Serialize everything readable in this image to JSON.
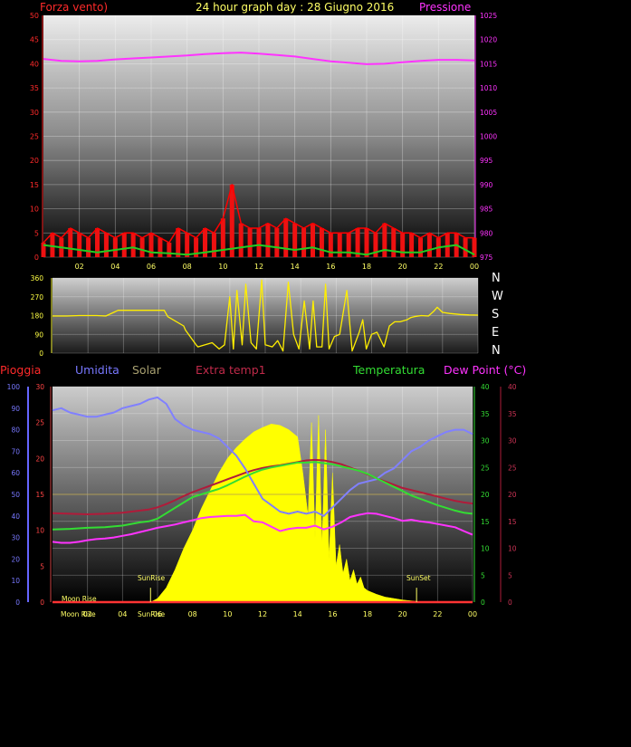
{
  "colors": {
    "background": "#000000",
    "wind_axis": "#ff2a2a",
    "pressure_axis": "#ff33ff",
    "time_ticks": "#ffff66",
    "dir_axis": "#ffff44",
    "rain_axis": "#6666ff",
    "humidity": "#8080ff",
    "solar": "#ffff00",
    "extra_temp": "#b01b3a",
    "temperature": "#33dd33",
    "dew_point": "#ff33ff"
  },
  "chart_data": [
    {
      "type": "line",
      "title": "24 hour graph day : 28 Giugno 2016",
      "ylabel_left": "Forza vento)",
      "ylabel_right": "Pressione",
      "x_ticks": [
        "02",
        "04",
        "06",
        "08",
        "10",
        "12",
        "14",
        "16",
        "18",
        "20",
        "22",
        "00"
      ],
      "y_left_ticks": [
        "0",
        "5",
        "10",
        "15",
        "20",
        "25",
        "30",
        "35",
        "40",
        "45",
        "50"
      ],
      "y_right_ticks": [
        "975",
        "980",
        "985",
        "990",
        "995",
        "1000",
        "1005",
        "1010",
        "1015",
        "1020",
        "1025"
      ],
      "ylim_left": [
        0,
        50
      ],
      "ylim_right": [
        975,
        1025
      ],
      "series": [
        {
          "axis": "right",
          "x": [
            0,
            1,
            2,
            3,
            4,
            5,
            6,
            7,
            8,
            9,
            10,
            11,
            12,
            13,
            14,
            15,
            16,
            17,
            18,
            19,
            20,
            21,
            22,
            23,
            24
          ],
          "values": [
            1016.0,
            1015.6,
            1015.5,
            1015.6,
            1015.9,
            1016.1,
            1016.3,
            1016.5,
            1016.7,
            1017.0,
            1017.2,
            1017.3,
            1017.1,
            1016.8,
            1016.5,
            1016.0,
            1015.5,
            1015.2,
            1014.9,
            1015.0,
            1015.3,
            1015.6,
            1015.8,
            1015.8,
            1015.7
          ]
        },
        {
          "axis": "left",
          "x": [
            0,
            0.5,
            1,
            1.5,
            2,
            2.5,
            3,
            3.5,
            4,
            4.5,
            5,
            5.5,
            6,
            6.5,
            7,
            7.5,
            8,
            8.5,
            9,
            9.5,
            10,
            10.5,
            11,
            11.5,
            12,
            12.5,
            13,
            13.5,
            14,
            14.5,
            15,
            15.5,
            16,
            16.5,
            17,
            17.5,
            18,
            18.5,
            19,
            19.5,
            20,
            20.5,
            21,
            21.5,
            22,
            22.5,
            23,
            23.5,
            24
          ],
          "values": [
            3,
            5,
            4,
            6,
            5,
            4,
            6,
            5,
            4,
            5,
            5,
            4,
            5,
            4,
            3,
            6,
            5,
            4,
            6,
            5,
            8,
            15,
            7,
            6,
            6,
            7,
            6,
            8,
            7,
            6,
            7,
            6,
            5,
            5,
            5,
            6,
            6,
            5,
            7,
            6,
            5,
            5,
            4,
            5,
            4,
            5,
            5,
            4,
            4
          ]
        },
        {
          "axis": "left",
          "x": [
            0,
            1,
            2,
            3,
            4,
            5,
            6,
            7,
            8,
            9,
            10,
            11,
            12,
            13,
            14,
            15,
            16,
            17,
            18,
            19,
            20,
            21,
            22,
            23,
            24
          ],
          "values": [
            2.5,
            2.0,
            1.5,
            1.0,
            1.5,
            2.0,
            1.0,
            0.8,
            0.5,
            1.0,
            1.5,
            2.0,
            2.5,
            2.0,
            1.5,
            2.0,
            1.0,
            1.0,
            0.5,
            1.5,
            1.0,
            1.0,
            2.0,
            2.5,
            0.5
          ]
        }
      ]
    },
    {
      "type": "line",
      "right_labels": [
        "N",
        "W",
        "S",
        "E",
        "N"
      ],
      "y_ticks": [
        "0",
        "90",
        "180",
        "270",
        "360"
      ],
      "ylim": [
        0,
        360
      ],
      "series": [
        {
          "x": [
            0,
            0.8,
            1.5,
            2.5,
            3.0,
            3.7,
            5.0,
            6.3,
            6.5,
            7.4,
            7.5,
            8.1,
            8.2,
            9.0,
            9.4,
            9.7,
            10.0,
            10.2,
            10.4,
            10.7,
            10.9,
            11.2,
            11.5,
            11.8,
            12.0,
            12.4,
            12.7,
            13.0,
            13.3,
            13.6,
            13.9,
            14.2,
            14.5,
            14.7,
            14.9,
            15.2,
            15.4,
            15.6,
            15.9,
            16.2,
            16.6,
            16.9,
            17.3,
            17.5,
            17.7,
            18.0,
            18.3,
            18.7,
            19.0,
            19.3,
            19.6,
            20.0,
            20.2,
            20.4,
            20.8,
            21.2,
            21.5,
            21.6,
            21.7,
            22.0,
            22.4,
            23.0,
            23.5,
            24.0
          ],
          "values": [
            178,
            178,
            180,
            180,
            178,
            205,
            205,
            205,
            175,
            130,
            110,
            40,
            30,
            50,
            20,
            40,
            270,
            20,
            300,
            40,
            330,
            50,
            20,
            350,
            40,
            30,
            60,
            10,
            340,
            90,
            20,
            250,
            20,
            250,
            30,
            30,
            330,
            20,
            80,
            90,
            300,
            10,
            100,
            160,
            20,
            90,
            100,
            30,
            130,
            150,
            150,
            160,
            170,
            175,
            180,
            178,
            200,
            210,
            220,
            195,
            190,
            185,
            183,
            182
          ]
        }
      ]
    },
    {
      "type": "line",
      "legend": [
        "Pioggia",
        "Umidita",
        "Solar",
        "Extra temp1",
        "Temperatura",
        "Dew Point (°C)"
      ],
      "y_rain_ticks": [
        "0",
        "10",
        "20",
        "30",
        "40",
        "50",
        "60",
        "70",
        "80",
        "90",
        "100"
      ],
      "y_solar_ticks": [
        "0",
        "5",
        "10",
        "15",
        "20",
        "25",
        "30"
      ],
      "y_temp_ticks": [
        "0",
        "5",
        "10",
        "15",
        "20",
        "25",
        "30",
        "35",
        "40"
      ],
      "y_dew_ticks": [
        "0",
        "5",
        "10",
        "15",
        "20",
        "25",
        "30",
        "35",
        "40"
      ],
      "ylim": [
        0,
        40
      ],
      "markers": [
        "Moon Rise",
        "SunRise",
        "SunSet"
      ],
      "series": [
        {
          "name": "Umidita",
          "axis": "humidity",
          "x": [
            0,
            0.5,
            1,
            1.5,
            2,
            2.5,
            3,
            3.5,
            4,
            4.5,
            5,
            5.5,
            6,
            6.5,
            7,
            7.5,
            8,
            8.5,
            9,
            9.5,
            10,
            10.5,
            11,
            11.5,
            12,
            12.5,
            13,
            13.5,
            14,
            14.5,
            15,
            15.5,
            16,
            16.5,
            17,
            17.5,
            18,
            18.5,
            19,
            19.5,
            20,
            20.5,
            21,
            21.5,
            22,
            22.5,
            23,
            23.5,
            24
          ],
          "values": [
            89,
            90,
            88,
            87,
            86,
            86,
            87,
            88,
            90,
            91,
            92,
            94,
            95,
            92,
            85,
            82,
            80,
            79,
            78,
            76,
            72,
            68,
            62,
            55,
            48,
            45,
            42,
            41,
            42,
            41,
            42,
            40,
            44,
            48,
            52,
            55,
            56,
            57,
            60,
            62,
            66,
            70,
            72,
            75,
            77,
            79,
            80,
            80,
            78
          ]
        },
        {
          "name": "Temperatura",
          "axis": "temp",
          "x": [
            0,
            1,
            2,
            3,
            4,
            5,
            5.5,
            6,
            6.5,
            7,
            7.5,
            8,
            8.5,
            9,
            9.5,
            10,
            10.5,
            11,
            11.5,
            12,
            12.5,
            13,
            13.5,
            14,
            14.5,
            15,
            15.5,
            16,
            16.5,
            17,
            17.5,
            18,
            18.5,
            19,
            19.5,
            20,
            20.5,
            21,
            21.5,
            22,
            22.5,
            23,
            23.5,
            24
          ],
          "values": [
            13.5,
            13.6,
            13.8,
            13.9,
            14.2,
            14.8,
            15.0,
            15.5,
            16.5,
            17.5,
            18.5,
            19.5,
            20.0,
            20.5,
            21.0,
            21.7,
            22.5,
            23.3,
            24.0,
            24.6,
            25.0,
            25.3,
            25.6,
            25.9,
            25.9,
            26.0,
            25.8,
            25.6,
            25.2,
            24.8,
            24.4,
            23.8,
            23.0,
            22.2,
            21.4,
            20.6,
            19.8,
            19.2,
            18.6,
            18.0,
            17.5,
            17.0,
            16.6,
            16.4
          ]
        },
        {
          "name": "Extra temp1",
          "axis": "temp",
          "x": [
            0,
            1,
            2,
            3,
            4,
            5,
            5.5,
            6,
            6.5,
            7,
            7.5,
            8,
            8.5,
            9,
            9.5,
            10,
            10.5,
            11,
            11.5,
            12,
            12.5,
            13,
            13.5,
            14,
            14.5,
            15,
            15.5,
            16,
            16.5,
            17,
            17.5,
            18,
            18.5,
            19,
            19.5,
            20,
            20.5,
            21,
            21.5,
            22,
            22.5,
            23,
            23.5,
            24
          ],
          "values": [
            16.5,
            16.4,
            16.3,
            16.4,
            16.6,
            17.0,
            17.2,
            17.6,
            18.2,
            18.9,
            19.7,
            20.4,
            21.0,
            21.6,
            22.2,
            22.8,
            23.4,
            24.0,
            24.5,
            24.9,
            25.2,
            25.4,
            25.7,
            26.0,
            26.3,
            26.4,
            26.3,
            26.0,
            25.6,
            25.0,
            24.4,
            23.7,
            23.0,
            22.4,
            21.8,
            21.2,
            20.8,
            20.4,
            20.0,
            19.6,
            19.2,
            18.8,
            18.5,
            18.3
          ]
        },
        {
          "name": "Dew Point (°C)",
          "axis": "dew",
          "x": [
            0,
            0.5,
            1,
            1.5,
            2,
            2.5,
            3,
            3.5,
            4,
            4.5,
            5,
            5.5,
            6,
            6.5,
            7,
            7.5,
            8,
            8.5,
            9,
            9.5,
            10,
            10.5,
            11,
            11.5,
            12,
            12.5,
            13,
            13.5,
            14,
            14.5,
            15,
            15.5,
            16,
            16.5,
            17,
            17.5,
            18,
            18.5,
            19,
            19.5,
            20,
            20.5,
            21,
            21.5,
            22,
            22.5,
            23,
            23.5,
            24
          ],
          "values": [
            11.2,
            11.0,
            11.0,
            11.2,
            11.5,
            11.7,
            11.8,
            12.0,
            12.3,
            12.6,
            13.0,
            13.4,
            13.8,
            14.1,
            14.4,
            14.8,
            15.2,
            15.6,
            15.8,
            15.9,
            16.0,
            16.0,
            16.2,
            15.0,
            14.8,
            14.0,
            13.2,
            13.6,
            13.8,
            13.8,
            14.2,
            13.5,
            14.0,
            14.8,
            15.8,
            16.2,
            16.5,
            16.4,
            16.0,
            15.6,
            15.1,
            15.3,
            15.0,
            14.8,
            14.5,
            14.2,
            13.9,
            13.2,
            12.5
          ]
        },
        {
          "name": "Solar",
          "axis": "solar",
          "x": [
            0,
            5.6,
            6.0,
            6.5,
            7.0,
            7.5,
            8.0,
            8.5,
            9.0,
            9.5,
            10.0,
            10.5,
            11.0,
            11.5,
            12.0,
            12.5,
            13.0,
            13.5,
            14.0,
            14.3,
            14.6,
            14.8,
            15.0,
            15.2,
            15.4,
            15.6,
            15.8,
            16.0,
            16.2,
            16.4,
            16.6,
            16.8,
            17.0,
            17.2,
            17.4,
            17.6,
            17.8,
            18.0,
            18.5,
            19.0,
            20.0,
            21.0,
            24.0
          ],
          "values": [
            0,
            0,
            0.5,
            2.0,
            4.5,
            7.5,
            10.0,
            13.0,
            15.5,
            18.0,
            20.0,
            21.5,
            22.7,
            23.7,
            24.3,
            24.8,
            24.6,
            24.0,
            23.0,
            18.0,
            12.0,
            25.0,
            9.0,
            26.0,
            8.0,
            24.0,
            6.0,
            18.0,
            5.0,
            8.0,
            4.0,
            6.0,
            3.0,
            4.5,
            2.5,
            3.5,
            2.0,
            1.6,
            1.1,
            0.7,
            0.3,
            0.05,
            0
          ]
        },
        {
          "name": "Pioggia",
          "axis": "rain",
          "x": [
            0,
            24
          ],
          "values": [
            0,
            0
          ]
        }
      ]
    }
  ]
}
